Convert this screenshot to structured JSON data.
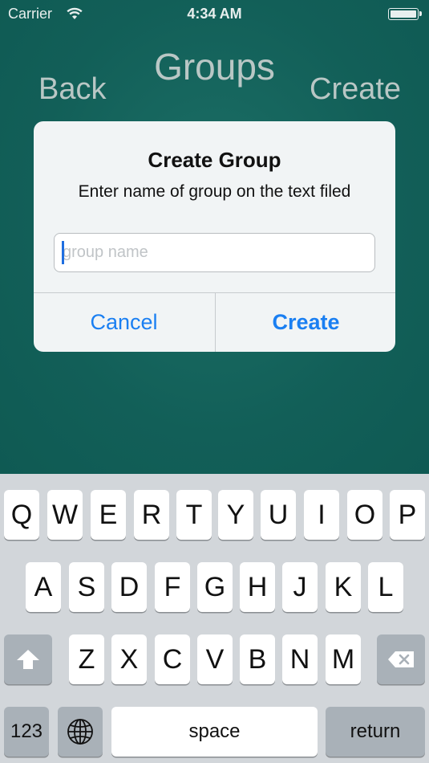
{
  "status_bar": {
    "carrier": "Carrier",
    "time": "4:34 AM"
  },
  "nav": {
    "title": "Groups",
    "back": "Back",
    "create": "Create"
  },
  "alert": {
    "title": "Create Group",
    "message": "Enter name of group on the text filed",
    "input_placeholder": "group name",
    "input_value": "",
    "cancel": "Cancel",
    "create": "Create"
  },
  "keyboard": {
    "row1": [
      "Q",
      "W",
      "E",
      "R",
      "T",
      "Y",
      "U",
      "I",
      "O",
      "P"
    ],
    "row2": [
      "A",
      "S",
      "D",
      "F",
      "G",
      "H",
      "J",
      "K",
      "L"
    ],
    "row3": [
      "Z",
      "X",
      "C",
      "V",
      "B",
      "N",
      "M"
    ],
    "numbers_key": "123",
    "space_key": "space",
    "return_key": "return",
    "icons": {
      "shift": "shift-icon",
      "delete": "delete-icon",
      "globe": "globe-icon"
    }
  },
  "colors": {
    "background": "#115c56",
    "accent": "#1a7ff2",
    "keyboard": "#d2d6da"
  }
}
